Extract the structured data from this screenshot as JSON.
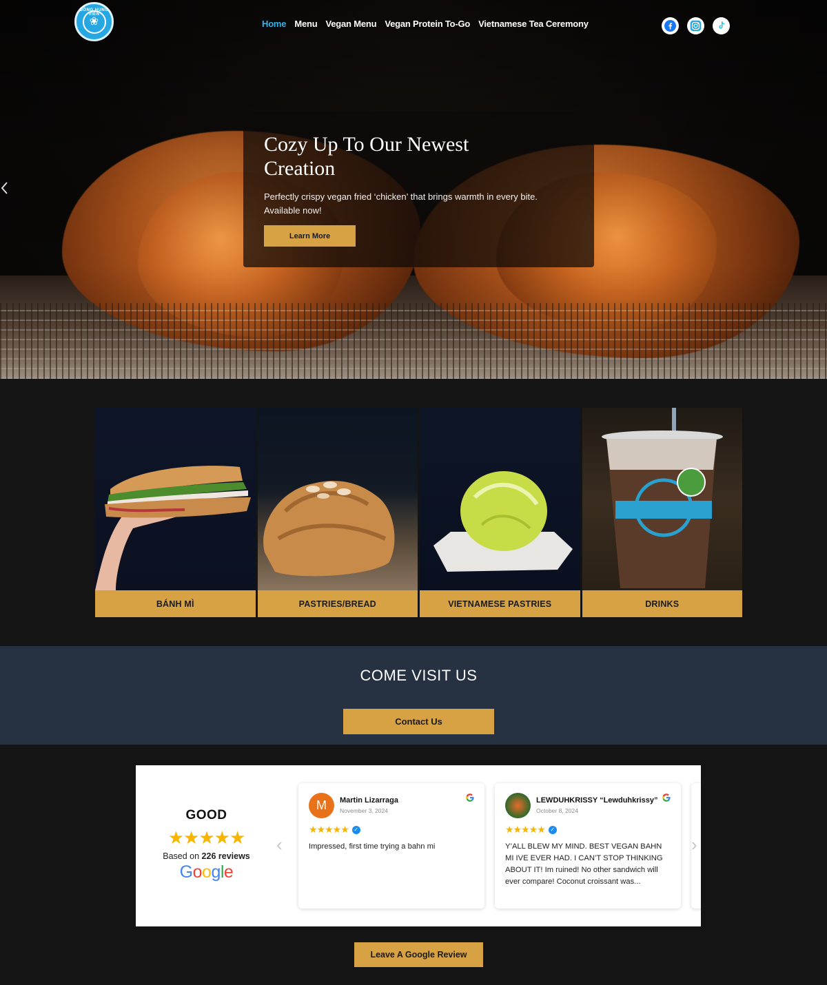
{
  "nav": {
    "logo_text": "ĐỒNG HUNG VIÊN",
    "links": [
      "Home",
      "Menu",
      "Vegan Menu",
      "Vegan Protein To-Go",
      "Vietnamese Tea Ceremony"
    ],
    "active": "Home",
    "socials": [
      "facebook-icon",
      "instagram-icon",
      "tiktok-icon"
    ]
  },
  "hero": {
    "title": "Cozy Up To Our Newest Creation",
    "description": "Perfectly crispy vegan fried ‘chicken’ that brings warmth in every bite. Available now!",
    "button": "Learn More"
  },
  "categories": [
    {
      "label": "BÁNH MÌ"
    },
    {
      "label": "PASTRIES/BREAD"
    },
    {
      "label": "VIETNAMESE PASTRIES"
    },
    {
      "label": "DRINKS"
    }
  ],
  "visit": {
    "title": "COME VISIT US",
    "button": "Contact Us"
  },
  "reviews": {
    "rating_word": "GOOD",
    "stars_display": "★★★★★",
    "based_prefix": "Based on",
    "count_text": "226 reviews",
    "google_word": "Google",
    "items": [
      {
        "initial": "M",
        "name": "Martin Lizarraga",
        "date": "November 3, 2024",
        "stars": "★★★★★",
        "text": "Impressed, first time trying a bahn mi"
      },
      {
        "initial": "",
        "name": "LEWDUHKRISSY “Lewduhkrissy”",
        "date": "October 8, 2024",
        "stars": "★★★★★",
        "text": "Y’ALL BLEW MY MIND. BEST VEGAN BAHN MI IVE EVER HAD. I CAN’T STOP THINKING ABOUT IT! Im ruined! No other sandwich will ever compare! Coconut croissant was..."
      }
    ],
    "leave_button": "Leave A Google Review"
  },
  "colors": {
    "gold": "#d7a244",
    "navy": "#263142",
    "accent_blue": "#3ab0e4",
    "background": "#141414"
  }
}
